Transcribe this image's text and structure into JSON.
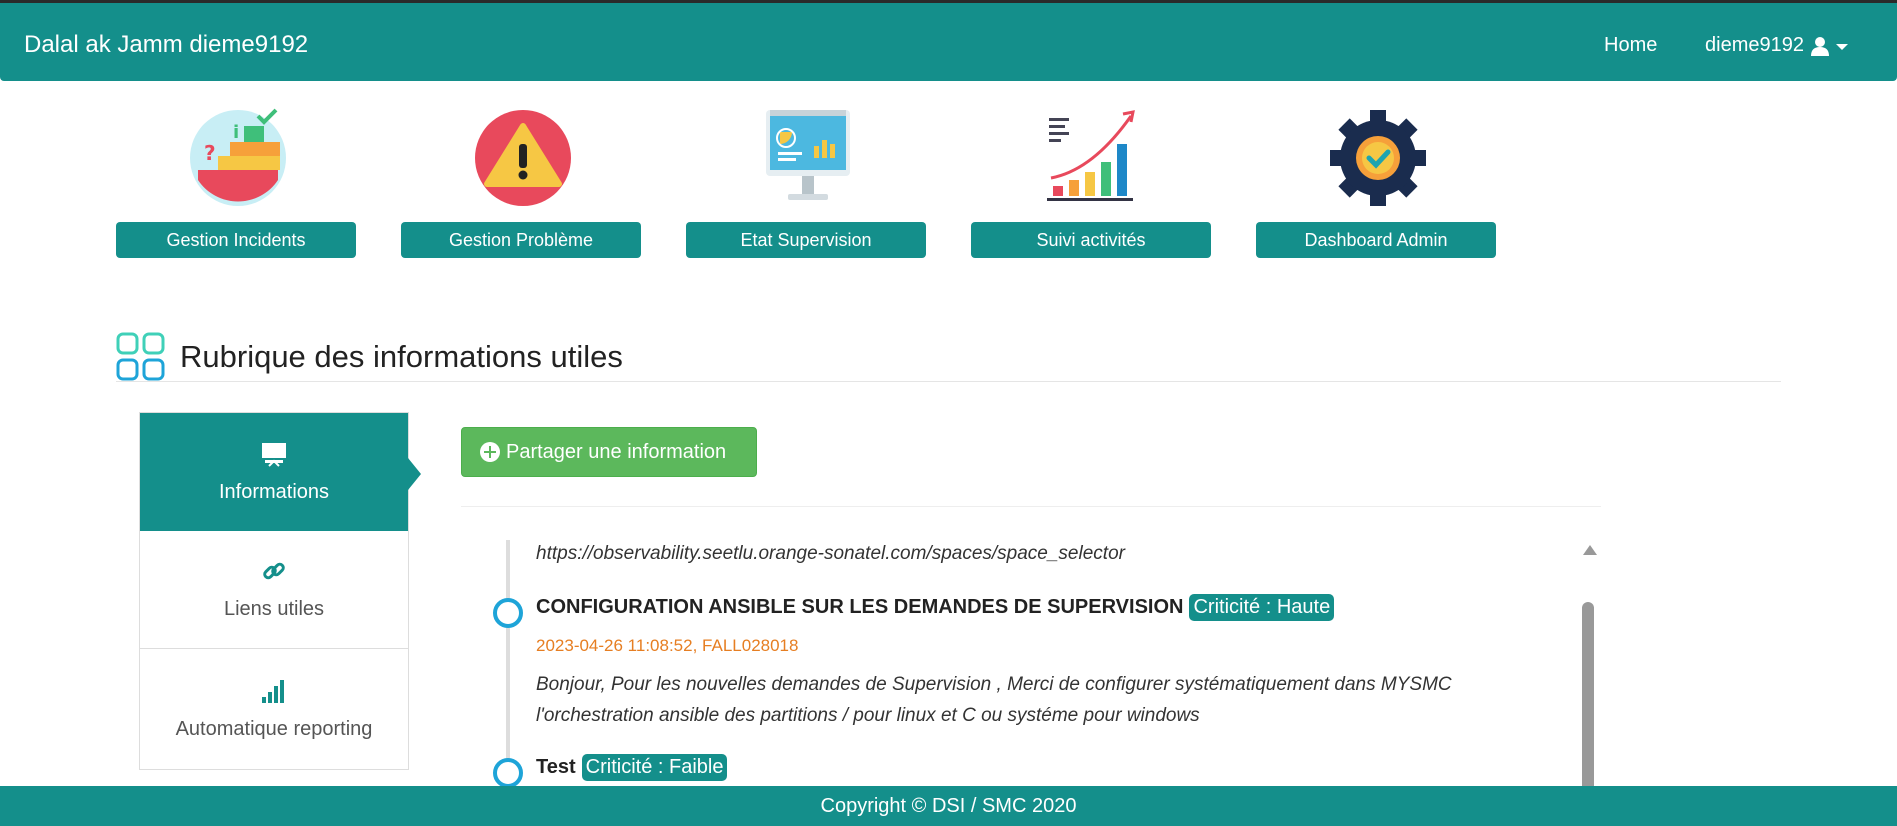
{
  "navbar": {
    "brand": "Dalal ak Jamm dieme9192",
    "home_label": "Home",
    "user_label": "dieme9192",
    "color": "#148f8b"
  },
  "tiles": [
    {
      "label": "Gestion Incidents",
      "icon": "incident-checklist-icon"
    },
    {
      "label": "Gestion Problème",
      "icon": "warning-icon"
    },
    {
      "label": "Etat Supervision",
      "icon": "monitor-dashboard-icon"
    },
    {
      "label": "Suivi activités",
      "icon": "growth-chart-icon"
    },
    {
      "label": "Dashboard Admin",
      "icon": "gear-check-icon"
    }
  ],
  "section": {
    "title": "Rubrique des informations utiles",
    "icon": "grid-squares-icon"
  },
  "sidebar": {
    "items": [
      {
        "label": "Informations",
        "icon": "presentation-icon",
        "active": true
      },
      {
        "label": "Liens utiles",
        "icon": "link-icon",
        "active": false
      },
      {
        "label": "Automatique reporting",
        "icon": "signal-bars-icon",
        "active": false
      }
    ]
  },
  "share_button": {
    "label": "Partager une information",
    "icon": "plus-circle-icon",
    "color": "#5cb85c"
  },
  "timeline": {
    "items": [
      {
        "url_text": "https://observability.seetlu.orange-sonatel.com/spaces/space_selector"
      },
      {
        "title": "CONFIGURATION ANSIBLE SUR LES DEMANDES DE SUPERVISION",
        "badge": "Criticité : Haute",
        "meta": "2023-04-26 11:08:52, FALL028018",
        "body_line1": "Bonjour, Pour les nouvelles demandes de Supervision , Merci de configurer systématiquement dans MYSMC",
        "body_line2": "l'orchestration ansible des partitions / pour linux et C ou systéme pour windows"
      },
      {
        "title": "Test",
        "badge": "Criticité : Faible"
      }
    ]
  },
  "footer": {
    "text": "Copyright © DSI / SMC 2020"
  }
}
